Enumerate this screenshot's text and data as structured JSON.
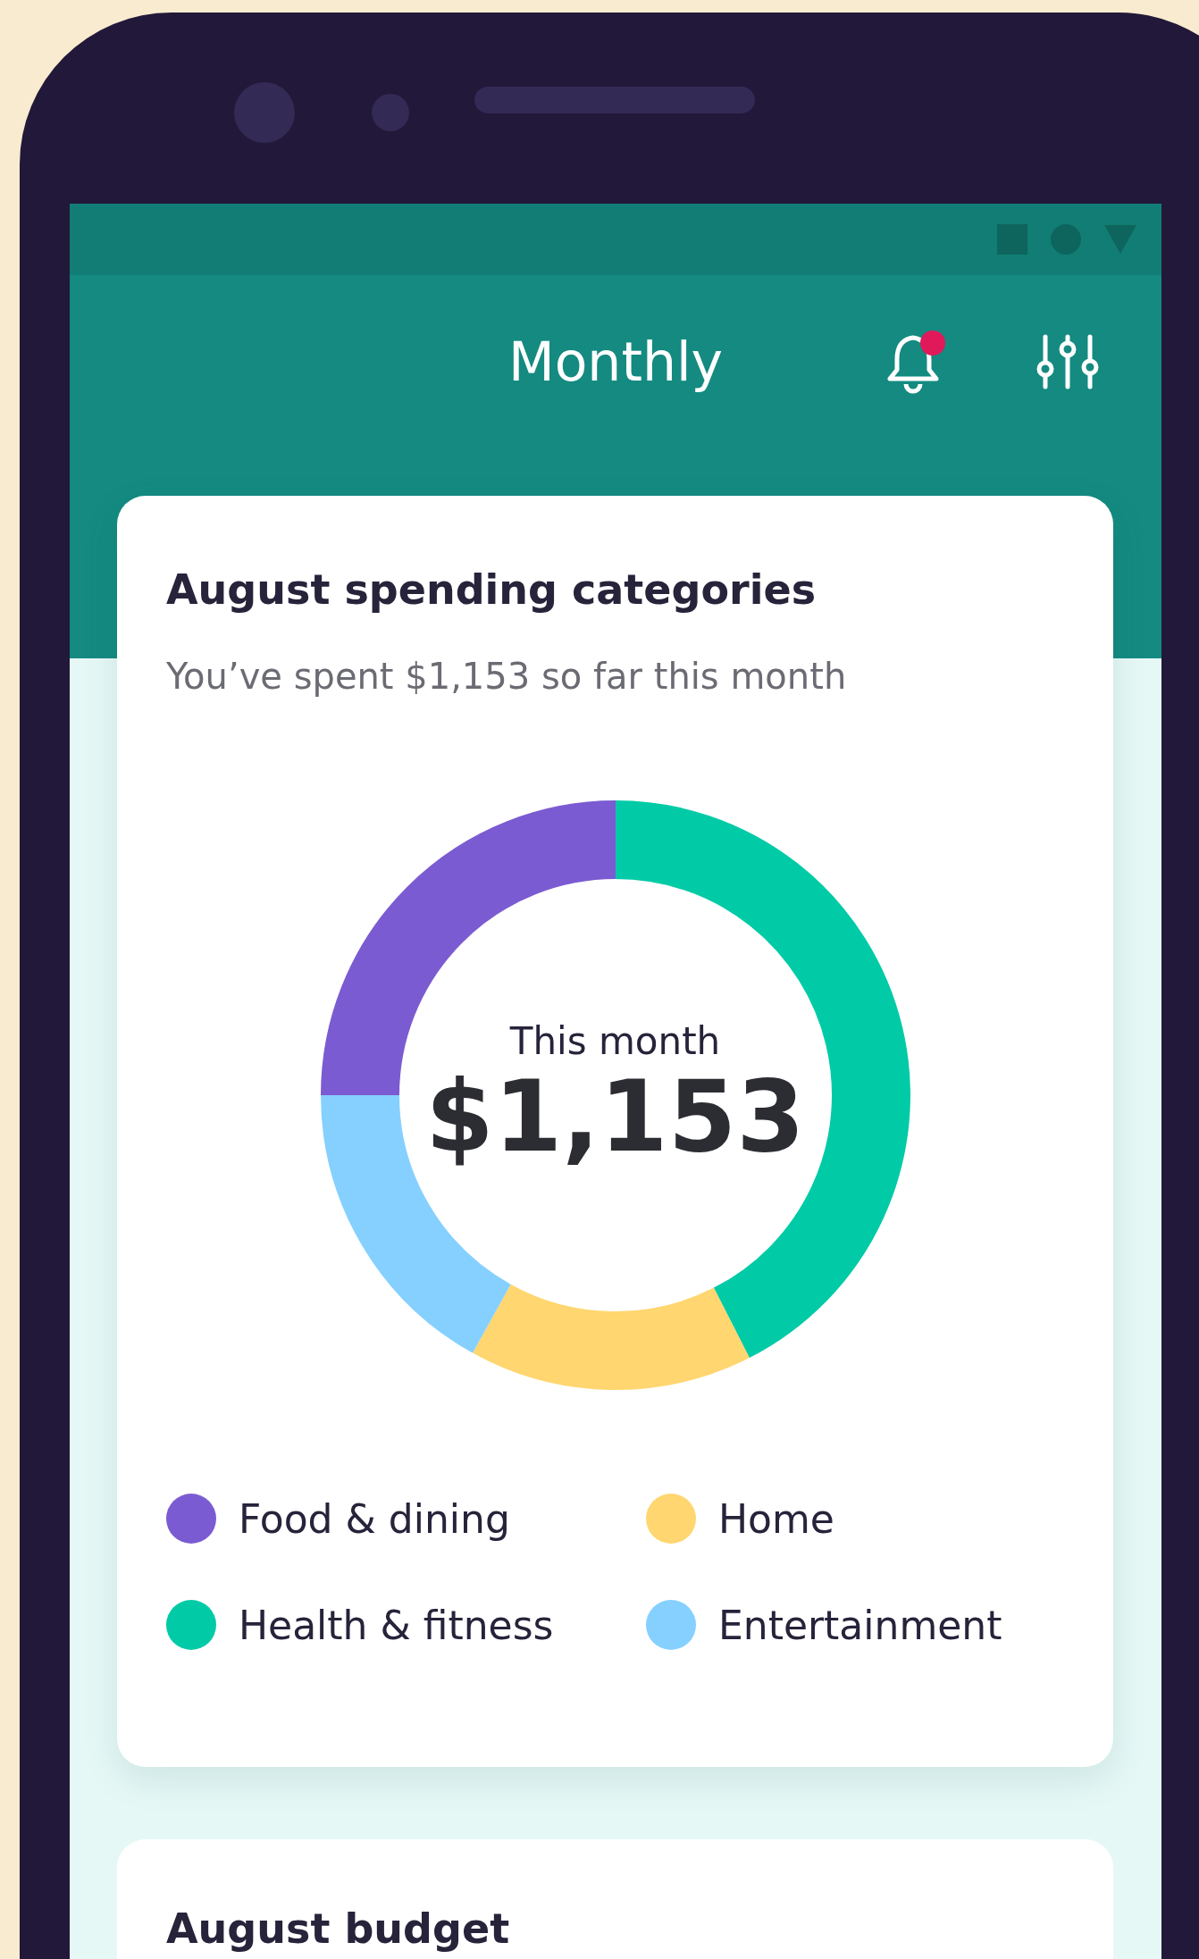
{
  "header": {
    "title": "Monthly"
  },
  "spending_card": {
    "title": "August spending categories",
    "subtitle": "You’ve spent $1,153 so far this month",
    "center_label": "This month",
    "center_amount": "$1,153",
    "legend": [
      {
        "label": "Food & dining",
        "color": "#7b5bd1"
      },
      {
        "label": "Home",
        "color": "#ffd66f"
      },
      {
        "label": "Health & fitness",
        "color": "#00cba6"
      },
      {
        "label": "Entertainment",
        "color": "#85d0ff"
      }
    ]
  },
  "budget_card": {
    "title": "August budget"
  }
}
